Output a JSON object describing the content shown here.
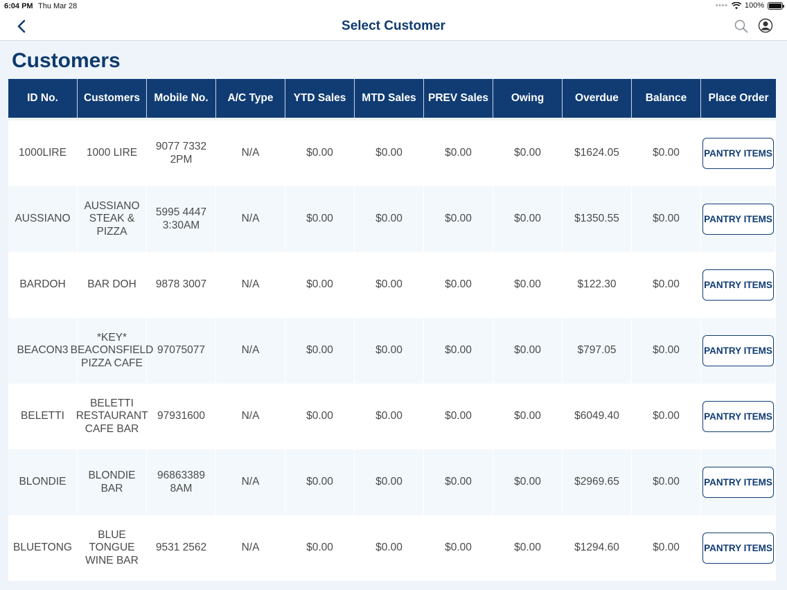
{
  "status_bar": {
    "time": "6:04 PM",
    "date": "Thu Mar 28",
    "battery": "100%"
  },
  "nav": {
    "title": "Select Customer"
  },
  "page_title": "Customers",
  "table": {
    "headers": [
      "ID No.",
      "Customers",
      "Mobile No.",
      "A/C Type",
      "YTD Sales",
      "MTD Sales",
      "PREV Sales",
      "Owing",
      "Overdue",
      "Balance",
      "Place Order"
    ],
    "button_label": "PANTRY ITEMS",
    "rows": [
      {
        "id": "1000LIRE",
        "customer": "1000 LIRE",
        "mobile": "9077 7332 2PM",
        "ac_type": "N/A",
        "ytd": "$0.00",
        "mtd": "$0.00",
        "prev": "$0.00",
        "owing": "$0.00",
        "overdue": "$1624.05",
        "balance": "$0.00"
      },
      {
        "id": "AUSSIANO",
        "customer": "AUSSIANO STEAK & PIZZA",
        "mobile": "5995 4447 3:30AM",
        "ac_type": "N/A",
        "ytd": "$0.00",
        "mtd": "$0.00",
        "prev": "$0.00",
        "owing": "$0.00",
        "overdue": "$1350.55",
        "balance": "$0.00"
      },
      {
        "id": "BARDOH",
        "customer": "BAR DOH",
        "mobile": "9878 3007",
        "ac_type": "N/A",
        "ytd": "$0.00",
        "mtd": "$0.00",
        "prev": "$0.00",
        "owing": "$0.00",
        "overdue": "$122.30",
        "balance": "$0.00"
      },
      {
        "id": "BEACON3",
        "customer": "*KEY* BEACONSFIELD PIZZA CAFE",
        "mobile": "97075077",
        "ac_type": "N/A",
        "ytd": "$0.00",
        "mtd": "$0.00",
        "prev": "$0.00",
        "owing": "$0.00",
        "overdue": "$797.05",
        "balance": "$0.00"
      },
      {
        "id": "BELETTI",
        "customer": "BELETTI RESTAURANT CAFE BAR",
        "mobile": "97931600",
        "ac_type": "N/A",
        "ytd": "$0.00",
        "mtd": "$0.00",
        "prev": "$0.00",
        "owing": "$0.00",
        "overdue": "$6049.40",
        "balance": "$0.00"
      },
      {
        "id": "BLONDIE",
        "customer": "BLONDIE BAR",
        "mobile": "96863389 8AM",
        "ac_type": "N/A",
        "ytd": "$0.00",
        "mtd": "$0.00",
        "prev": "$0.00",
        "owing": "$0.00",
        "overdue": "$2969.65",
        "balance": "$0.00"
      },
      {
        "id": "BLUETONG",
        "customer": "BLUE TONGUE WINE BAR",
        "mobile": "9531 2562",
        "ac_type": "N/A",
        "ytd": "$0.00",
        "mtd": "$0.00",
        "prev": "$0.00",
        "owing": "$0.00",
        "overdue": "$1294.60",
        "balance": "$0.00"
      }
    ]
  },
  "icons": {
    "back": "chevron-left-icon",
    "search": "search-icon",
    "profile": "user-icon"
  },
  "colors": {
    "brand": "#103c73",
    "background": "#eef4fa"
  }
}
